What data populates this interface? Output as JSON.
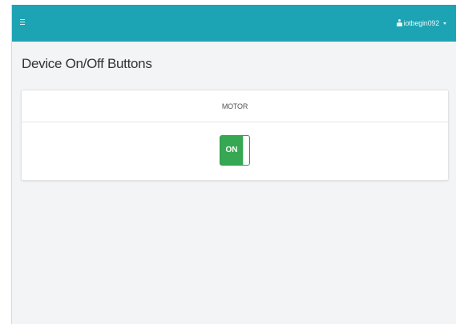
{
  "navbar": {
    "menu_icon": "hamburger-icon",
    "user_icon": "user-icon",
    "username": "iotbegin092",
    "dropdown_icon": "caret-down-icon",
    "background_color": "#1da4b4"
  },
  "page": {
    "title": "Device On/Off Buttons"
  },
  "device": {
    "name": "MOTOR",
    "toggle_label": "ON",
    "toggle_color": "#36a853",
    "state": "on"
  }
}
